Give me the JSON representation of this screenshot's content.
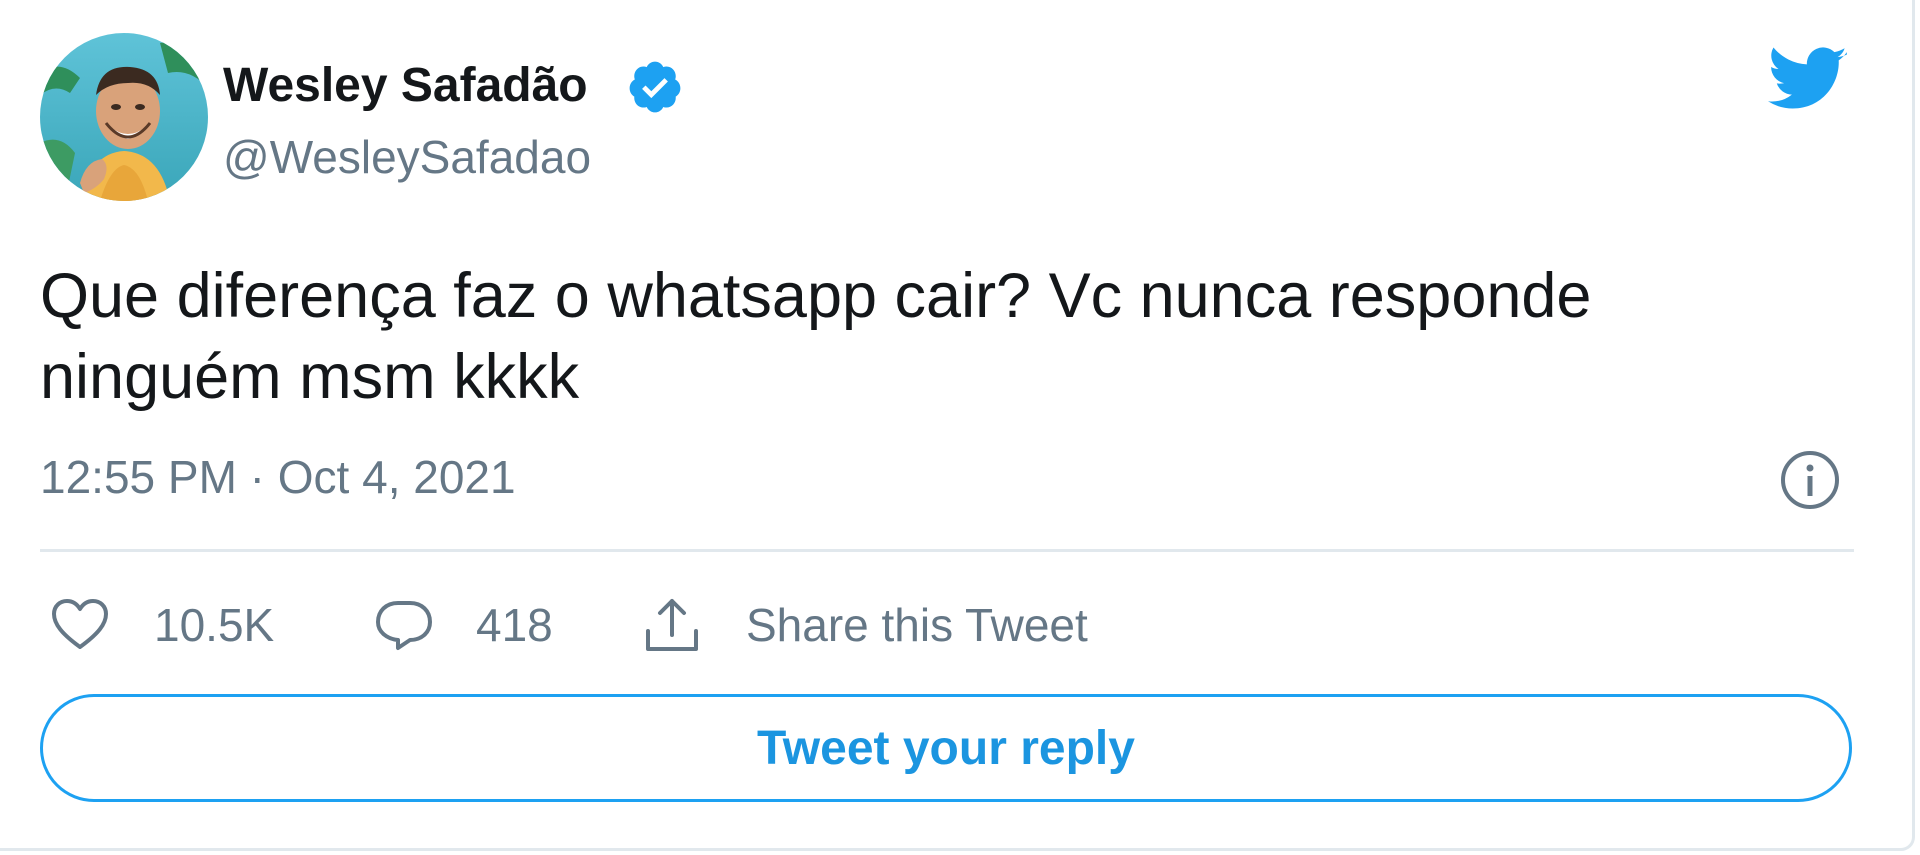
{
  "tweet": {
    "author": {
      "name": "Wesley Safadão",
      "handle": "@WesleySafadao",
      "verified": true
    },
    "text": "Que diferença faz o whatsapp cair? Vc nunca responde ninguém msm kkkk",
    "timestamp": "12:55 PM · Oct 4, 2021",
    "likes": "10.5K",
    "replies": "418",
    "share_label": "Share this Tweet",
    "reply_button_label": "Tweet your reply"
  },
  "icons": {
    "brand": "twitter-bird-icon",
    "verified": "verified-badge-icon",
    "info": "info-icon",
    "like": "heart-icon",
    "reply": "speech-bubble-icon",
    "share": "share-upload-icon"
  },
  "colors": {
    "brand_blue": "#1da1f2",
    "reply_text_blue": "#1b95e0",
    "primary_text": "#14171a",
    "secondary_text": "#657786",
    "divider": "#e1e8ed"
  }
}
